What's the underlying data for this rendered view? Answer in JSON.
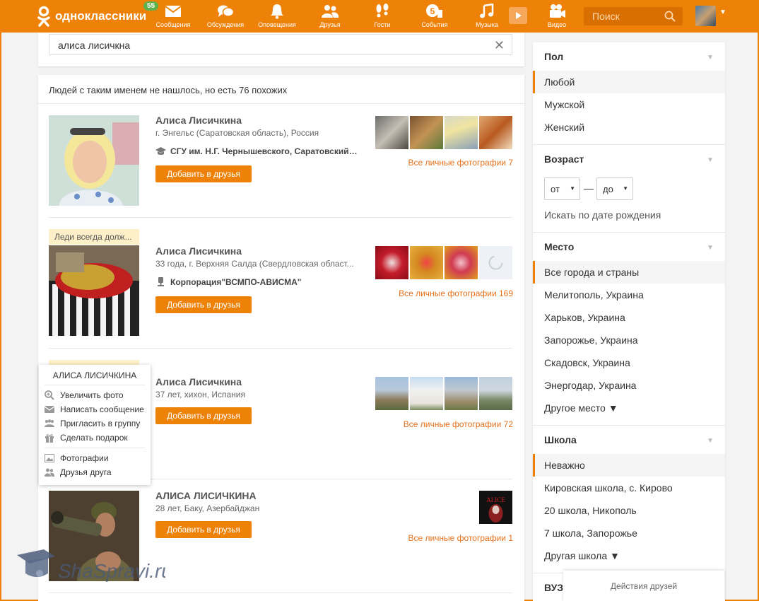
{
  "header": {
    "logo_text": "одноклассники",
    "notifications_badge": "55",
    "nav": [
      {
        "label": "Сообщения",
        "icon": "envelope-icon"
      },
      {
        "label": "Обсуждения",
        "icon": "chat-bubbles-icon"
      },
      {
        "label": "Оповещения",
        "icon": "bell-icon"
      },
      {
        "label": "Друзья",
        "icon": "friends-icon"
      },
      {
        "label": "Гости",
        "icon": "footprints-icon"
      },
      {
        "label": "События",
        "icon": "events-icon"
      },
      {
        "label": "Музыка",
        "icon": "music-note-icon"
      },
      {
        "label": "Видео",
        "icon": "video-camera-icon"
      }
    ],
    "search_placeholder": "Поиск"
  },
  "search": {
    "query": "алиса лисичкна",
    "result_note": "Людей с таким именем не нашлось, но есть 76 похожих"
  },
  "people": [
    {
      "name": "Алиса Лисичкина",
      "info": "г. Энгельс (Саратовская область), Россия",
      "work": "СГУ им. Н.Г. Чернышевского, Саратовский…",
      "add_label": "Добавить в друзья",
      "all_photos": "Все личные фотографии 7"
    },
    {
      "status": "Леди всегда долж...",
      "name": "Алиса Лисичкина",
      "info": "33 года, г. Верхняя Салда (Свердловская област...",
      "work": "Корпорация\"ВСМПО-АВИСМА\"",
      "add_label": "Добавить в друзья",
      "all_photos": "Все личные фотографии 169"
    },
    {
      "name": "Алиса Лисичкина",
      "info": "37 лет, хихон, Испания",
      "add_label": "Добавить в друзья",
      "all_photos": "Все личные фотографии 72"
    },
    {
      "name": "АЛИСА ЛИСИЧКИНА",
      "info": "28 лет, Баку, Азербайджан",
      "add_label": "Добавить в друзья",
      "all_photos": "Все личные фотографии 1"
    }
  ],
  "popup": {
    "title": "АЛИСА ЛИСИЧКИНА",
    "items": [
      {
        "label": "Увеличить фото",
        "icon": "zoom-icon"
      },
      {
        "label": "Написать сообщение",
        "icon": "envelope-icon"
      },
      {
        "label": "Пригласить в группу",
        "icon": "group-icon"
      },
      {
        "label": "Сделать подарок",
        "icon": "gift-icon"
      }
    ],
    "items2": [
      {
        "label": "Фотографии",
        "icon": "photo-icon"
      },
      {
        "label": "Друзья друга",
        "icon": "friends-icon"
      }
    ]
  },
  "filters": {
    "gender": {
      "title": "Пол",
      "options": [
        "Любой",
        "Мужской",
        "Женский"
      ],
      "selected": "Любой"
    },
    "age": {
      "title": "Возраст",
      "from": "от",
      "to": "до",
      "dash": "—",
      "birth_link": "Искать по дате рождения"
    },
    "place": {
      "title": "Место",
      "options": [
        "Все города и страны",
        "Мелитополь, Украина",
        "Харьков, Украина",
        "Запорожье, Украина",
        "Скадовск, Украина",
        "Энергодар, Украина",
        "Другое место ▼"
      ],
      "selected": "Все города и страны"
    },
    "school": {
      "title": "Школа",
      "options": [
        "Неважно",
        "Кировская школа, с. Кирово",
        "20 школа, Никополь",
        "7 школа, Запорожье",
        "Другая школа ▼"
      ],
      "selected": "Неважно"
    },
    "university": {
      "title": "ВУЗ"
    }
  },
  "friends_actions": "Действия друзей",
  "watermark_text": "ShaSpravi.ru",
  "colors": {
    "accent": "#ee8208",
    "link": "#e5711c",
    "badge": "#5eb14a"
  }
}
